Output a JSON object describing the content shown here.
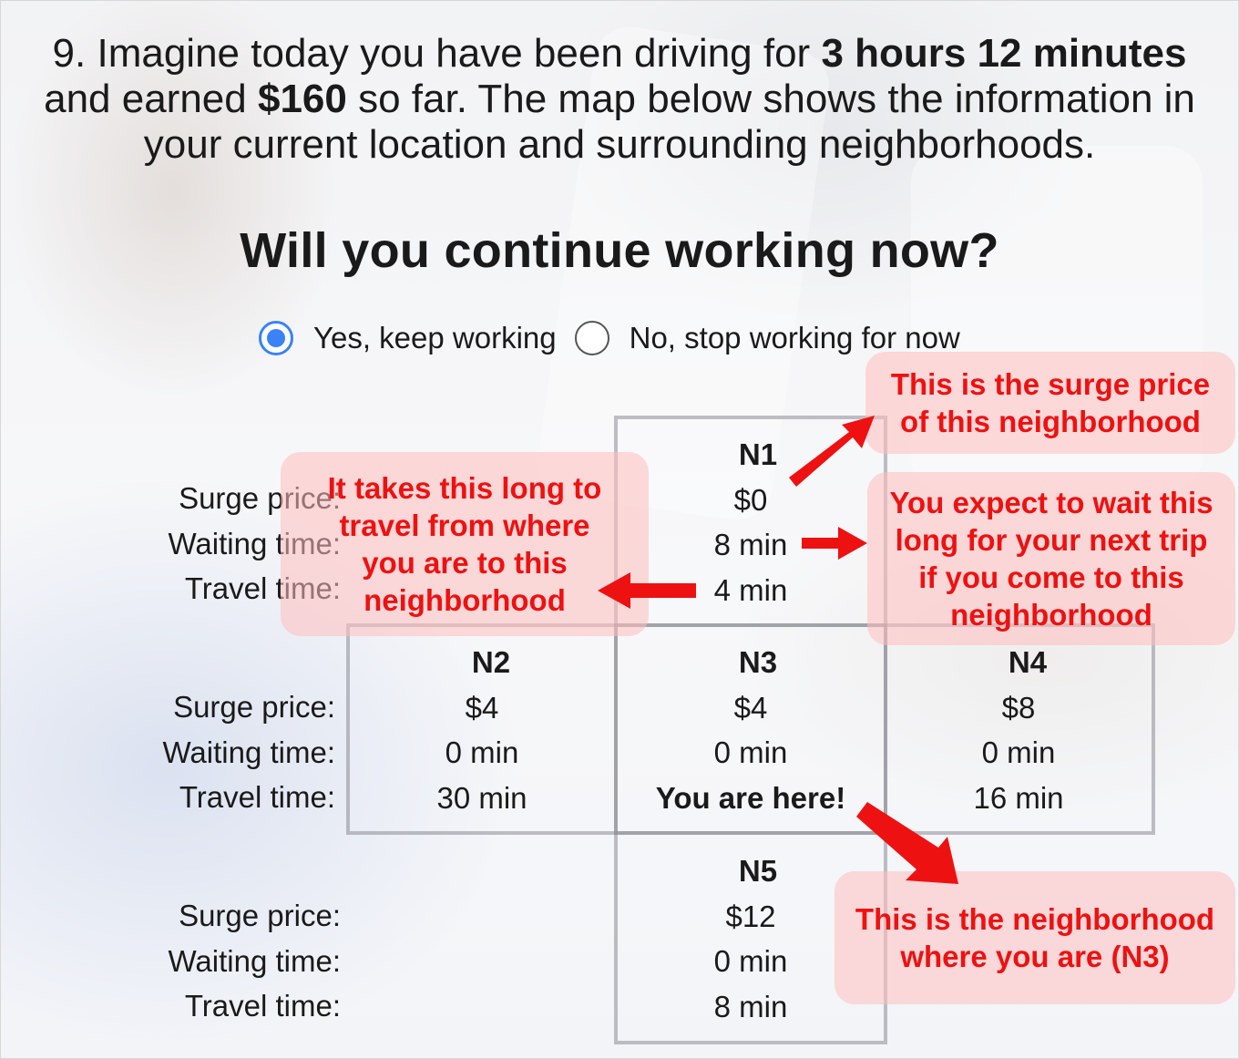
{
  "question": {
    "number": "9.",
    "part1": "Imagine today you have been driving for",
    "hours": "3 hours 12 minutes",
    "part2": "and earned",
    "earned": "$160",
    "part3": "so far. The map below shows the information in",
    "part4": "your current location and surrounding neighborhoods."
  },
  "heading": "Will you continue working now?",
  "options": [
    {
      "label": "Yes, keep working",
      "checked": true
    },
    {
      "label": "No, stop working for now",
      "checked": false
    }
  ],
  "labels": {
    "surge": "Surge price:",
    "waiting": "Waiting time:",
    "travel": "Travel time:"
  },
  "neighborhoods": {
    "n1": {
      "name": "N1",
      "surge": "$0",
      "waiting": "8 min",
      "travel": "4 min"
    },
    "n2": {
      "name": "N2",
      "surge": "$4",
      "waiting": "0 min",
      "travel": "30 min"
    },
    "n3": {
      "name": "N3",
      "surge": "$4",
      "waiting": "0 min",
      "travel": "You are here!"
    },
    "n4": {
      "name": "N4",
      "surge": "$8",
      "waiting": "0 min",
      "travel": "16 min"
    },
    "n5": {
      "name": "N5",
      "surge": "$12",
      "waiting": "0 min",
      "travel": "8 min"
    }
  },
  "annotations": {
    "surge": [
      "This is the surge price",
      "of this neighborhood"
    ],
    "travel": [
      "It takes this long to",
      "travel from where",
      "you are to this",
      "neighborhood"
    ],
    "waiting": [
      "You expect to wait this",
      "long for your next trip",
      "if you come to this",
      "neighborhood"
    ],
    "here": [
      "This is the neighborhood",
      "where you are (N3)"
    ]
  },
  "colors": {
    "annotation_text": "#ee1111",
    "annotation_bg": "#ffbebe",
    "radio_checked": "#3b82f6",
    "grid_border": "#8c8c96"
  }
}
